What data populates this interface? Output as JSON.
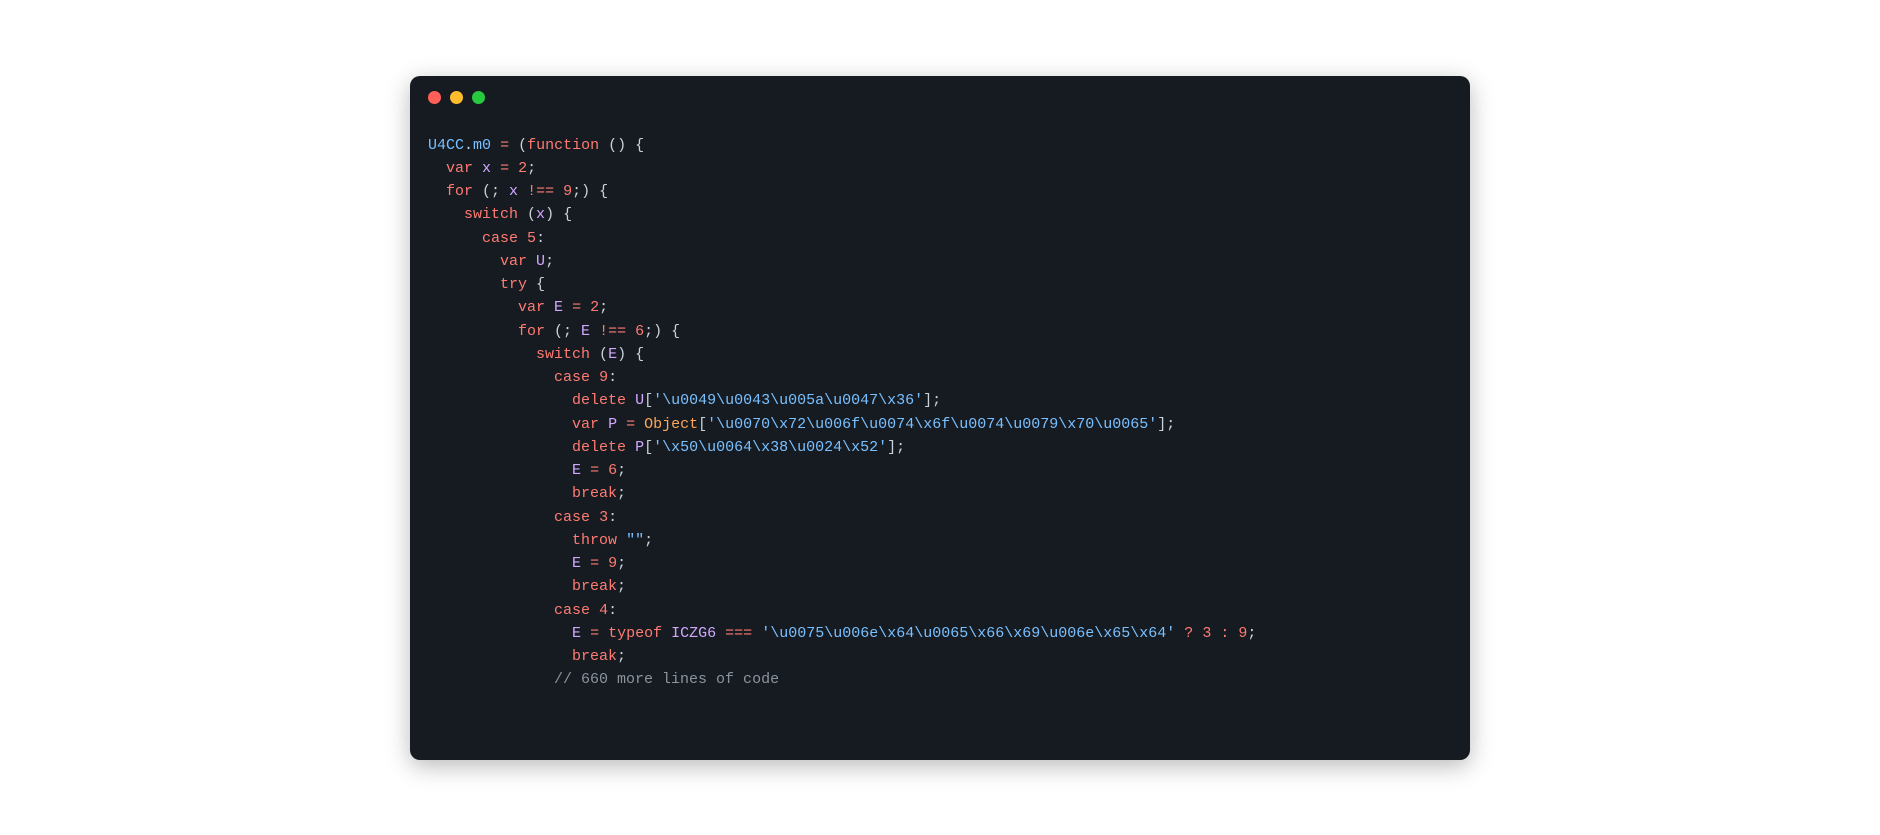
{
  "code": {
    "lines": [
      {
        "indent": 0,
        "tokens": [
          {
            "t": "U4CC",
            "c": "ident"
          },
          {
            "t": ".",
            "c": "punct"
          },
          {
            "t": "m0",
            "c": "ident"
          },
          {
            "t": " ",
            "c": "punct"
          },
          {
            "t": "=",
            "c": "op"
          },
          {
            "t": " (",
            "c": "punct"
          },
          {
            "t": "function",
            "c": "kw"
          },
          {
            "t": " () {",
            "c": "punct"
          }
        ]
      },
      {
        "indent": 1,
        "tokens": [
          {
            "t": "var",
            "c": "kw"
          },
          {
            "t": " ",
            "c": "punct"
          },
          {
            "t": "x",
            "c": "var"
          },
          {
            "t": " ",
            "c": "punct"
          },
          {
            "t": "=",
            "c": "op"
          },
          {
            "t": " ",
            "c": "punct"
          },
          {
            "t": "2",
            "c": "num"
          },
          {
            "t": ";",
            "c": "punct"
          }
        ]
      },
      {
        "indent": 1,
        "tokens": [
          {
            "t": "for",
            "c": "kw"
          },
          {
            "t": " (; ",
            "c": "punct"
          },
          {
            "t": "x",
            "c": "var"
          },
          {
            "t": " ",
            "c": "punct"
          },
          {
            "t": "!==",
            "c": "op"
          },
          {
            "t": " ",
            "c": "punct"
          },
          {
            "t": "9",
            "c": "num"
          },
          {
            "t": ";) {",
            "c": "punct"
          }
        ]
      },
      {
        "indent": 2,
        "tokens": [
          {
            "t": "switch",
            "c": "kw"
          },
          {
            "t": " (",
            "c": "punct"
          },
          {
            "t": "x",
            "c": "var"
          },
          {
            "t": ") {",
            "c": "punct"
          }
        ]
      },
      {
        "indent": 3,
        "tokens": [
          {
            "t": "case",
            "c": "kw"
          },
          {
            "t": " ",
            "c": "punct"
          },
          {
            "t": "5",
            "c": "num"
          },
          {
            "t": ":",
            "c": "punct"
          }
        ]
      },
      {
        "indent": 4,
        "tokens": [
          {
            "t": "var",
            "c": "kw"
          },
          {
            "t": " ",
            "c": "punct"
          },
          {
            "t": "U",
            "c": "var"
          },
          {
            "t": ";",
            "c": "punct"
          }
        ]
      },
      {
        "indent": 4,
        "tokens": [
          {
            "t": "try",
            "c": "kw"
          },
          {
            "t": " {",
            "c": "punct"
          }
        ]
      },
      {
        "indent": 5,
        "tokens": [
          {
            "t": "var",
            "c": "kw"
          },
          {
            "t": " ",
            "c": "punct"
          },
          {
            "t": "E",
            "c": "var"
          },
          {
            "t": " ",
            "c": "punct"
          },
          {
            "t": "=",
            "c": "op"
          },
          {
            "t": " ",
            "c": "punct"
          },
          {
            "t": "2",
            "c": "num"
          },
          {
            "t": ";",
            "c": "punct"
          }
        ]
      },
      {
        "indent": 5,
        "tokens": [
          {
            "t": "for",
            "c": "kw"
          },
          {
            "t": " (; ",
            "c": "punct"
          },
          {
            "t": "E",
            "c": "var"
          },
          {
            "t": " ",
            "c": "punct"
          },
          {
            "t": "!==",
            "c": "op"
          },
          {
            "t": " ",
            "c": "punct"
          },
          {
            "t": "6",
            "c": "num"
          },
          {
            "t": ";) {",
            "c": "punct"
          }
        ]
      },
      {
        "indent": 6,
        "tokens": [
          {
            "t": "switch",
            "c": "kw"
          },
          {
            "t": " (",
            "c": "punct"
          },
          {
            "t": "E",
            "c": "var"
          },
          {
            "t": ") {",
            "c": "punct"
          }
        ]
      },
      {
        "indent": 7,
        "tokens": [
          {
            "t": "case",
            "c": "kw"
          },
          {
            "t": " ",
            "c": "punct"
          },
          {
            "t": "9",
            "c": "num"
          },
          {
            "t": ":",
            "c": "punct"
          }
        ]
      },
      {
        "indent": 8,
        "tokens": [
          {
            "t": "delete",
            "c": "kw"
          },
          {
            "t": " ",
            "c": "punct"
          },
          {
            "t": "U",
            "c": "var"
          },
          {
            "t": "[",
            "c": "punct"
          },
          {
            "t": "'\\u0049\\u0043\\u005a\\u0047\\x36'",
            "c": "str"
          },
          {
            "t": "];",
            "c": "punct"
          }
        ]
      },
      {
        "indent": 8,
        "tokens": [
          {
            "t": "var",
            "c": "kw"
          },
          {
            "t": " ",
            "c": "punct"
          },
          {
            "t": "P",
            "c": "var"
          },
          {
            "t": " ",
            "c": "punct"
          },
          {
            "t": "=",
            "c": "op"
          },
          {
            "t": " ",
            "c": "punct"
          },
          {
            "t": "Object",
            "c": "obj"
          },
          {
            "t": "[",
            "c": "punct"
          },
          {
            "t": "'\\u0070\\x72\\u006f\\u0074\\x6f\\u0074\\u0079\\x70\\u0065'",
            "c": "str"
          },
          {
            "t": "];",
            "c": "punct"
          }
        ]
      },
      {
        "indent": 8,
        "tokens": [
          {
            "t": "delete",
            "c": "kw"
          },
          {
            "t": " ",
            "c": "punct"
          },
          {
            "t": "P",
            "c": "var"
          },
          {
            "t": "[",
            "c": "punct"
          },
          {
            "t": "'\\x50\\u0064\\x38\\u0024\\x52'",
            "c": "str"
          },
          {
            "t": "];",
            "c": "punct"
          }
        ]
      },
      {
        "indent": 8,
        "tokens": [
          {
            "t": "E",
            "c": "var"
          },
          {
            "t": " ",
            "c": "punct"
          },
          {
            "t": "=",
            "c": "op"
          },
          {
            "t": " ",
            "c": "punct"
          },
          {
            "t": "6",
            "c": "num"
          },
          {
            "t": ";",
            "c": "punct"
          }
        ]
      },
      {
        "indent": 8,
        "tokens": [
          {
            "t": "break",
            "c": "kw"
          },
          {
            "t": ";",
            "c": "punct"
          }
        ]
      },
      {
        "indent": 7,
        "tokens": [
          {
            "t": "case",
            "c": "kw"
          },
          {
            "t": " ",
            "c": "punct"
          },
          {
            "t": "3",
            "c": "num"
          },
          {
            "t": ":",
            "c": "punct"
          }
        ]
      },
      {
        "indent": 8,
        "tokens": [
          {
            "t": "throw",
            "c": "kw"
          },
          {
            "t": " ",
            "c": "punct"
          },
          {
            "t": "\"\"",
            "c": "str"
          },
          {
            "t": ";",
            "c": "punct"
          }
        ]
      },
      {
        "indent": 8,
        "tokens": [
          {
            "t": "E",
            "c": "var"
          },
          {
            "t": " ",
            "c": "punct"
          },
          {
            "t": "=",
            "c": "op"
          },
          {
            "t": " ",
            "c": "punct"
          },
          {
            "t": "9",
            "c": "num"
          },
          {
            "t": ";",
            "c": "punct"
          }
        ]
      },
      {
        "indent": 8,
        "tokens": [
          {
            "t": "break",
            "c": "kw"
          },
          {
            "t": ";",
            "c": "punct"
          }
        ]
      },
      {
        "indent": 7,
        "tokens": [
          {
            "t": "case",
            "c": "kw"
          },
          {
            "t": " ",
            "c": "punct"
          },
          {
            "t": "4",
            "c": "num"
          },
          {
            "t": ":",
            "c": "punct"
          }
        ]
      },
      {
        "indent": 8,
        "tokens": [
          {
            "t": "E",
            "c": "var"
          },
          {
            "t": " ",
            "c": "punct"
          },
          {
            "t": "=",
            "c": "op"
          },
          {
            "t": " ",
            "c": "punct"
          },
          {
            "t": "typeof",
            "c": "kw"
          },
          {
            "t": " ",
            "c": "punct"
          },
          {
            "t": "ICZG6",
            "c": "var"
          },
          {
            "t": " ",
            "c": "punct"
          },
          {
            "t": "===",
            "c": "op"
          },
          {
            "t": " ",
            "c": "punct"
          },
          {
            "t": "'\\u0075\\u006e\\x64\\u0065\\x66\\x69\\u006e\\x65\\x64'",
            "c": "str"
          },
          {
            "t": " ",
            "c": "punct"
          },
          {
            "t": "?",
            "c": "op"
          },
          {
            "t": " ",
            "c": "punct"
          },
          {
            "t": "3",
            "c": "num"
          },
          {
            "t": " ",
            "c": "punct"
          },
          {
            "t": ":",
            "c": "op"
          },
          {
            "t": " ",
            "c": "punct"
          },
          {
            "t": "9",
            "c": "num"
          },
          {
            "t": ";",
            "c": "punct"
          }
        ]
      },
      {
        "indent": 8,
        "tokens": [
          {
            "t": "break",
            "c": "kw"
          },
          {
            "t": ";",
            "c": "punct"
          }
        ]
      },
      {
        "indent": 7,
        "tokens": [
          {
            "t": "// 660 more lines of code",
            "c": "comment"
          }
        ]
      }
    ]
  }
}
